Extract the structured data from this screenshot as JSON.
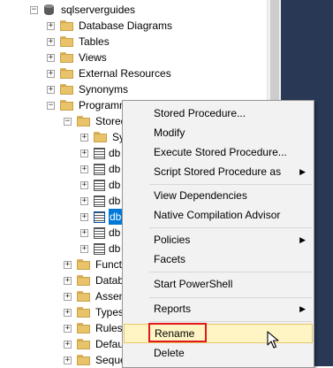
{
  "tree": {
    "db_name": "sqlserverguides",
    "items": [
      {
        "label": "Database Diagrams",
        "expander": "+"
      },
      {
        "label": "Tables",
        "expander": "+"
      },
      {
        "label": "Views",
        "expander": "+"
      },
      {
        "label": "External Resources",
        "expander": "+"
      },
      {
        "label": "Synonyms",
        "expander": "+"
      },
      {
        "label": "Programm",
        "expander": "−"
      },
      {
        "label": "Stored",
        "expander": "−"
      },
      {
        "label": "Sy",
        "expander": "+"
      },
      {
        "label": "db",
        "expander": "+"
      },
      {
        "label": "db",
        "expander": "+"
      },
      {
        "label": "db",
        "expander": "+"
      },
      {
        "label": "db",
        "expander": "+"
      },
      {
        "label": "db",
        "expander": "+",
        "selected": true
      },
      {
        "label": "db",
        "expander": "+"
      },
      {
        "label": "db",
        "expander": "+"
      },
      {
        "label": "Functi",
        "expander": "+"
      },
      {
        "label": "Datab",
        "expander": "+"
      },
      {
        "label": "Assen",
        "expander": "+"
      },
      {
        "label": "Types",
        "expander": "+"
      },
      {
        "label": "Rules",
        "expander": "+"
      },
      {
        "label": "Defau",
        "expander": "+"
      },
      {
        "label": "Seque",
        "expander": "+"
      }
    ],
    "root_expander": "−"
  },
  "context_menu": {
    "items": [
      {
        "label": "Stored Procedure...",
        "submenu": false
      },
      {
        "label": "Modify",
        "submenu": false
      },
      {
        "label": "Execute Stored Procedure...",
        "submenu": false
      },
      {
        "label": "Script Stored Procedure as",
        "submenu": true
      },
      {
        "label": "View Dependencies",
        "submenu": false
      },
      {
        "label": "Native Compilation Advisor",
        "submenu": false
      },
      {
        "label": "Policies",
        "submenu": true
      },
      {
        "label": "Facets",
        "submenu": false
      },
      {
        "label": "Start PowerShell",
        "submenu": false
      },
      {
        "label": "Reports",
        "submenu": true
      },
      {
        "label": "Rename",
        "submenu": false,
        "highlighted": true
      },
      {
        "label": "Delete",
        "submenu": false
      }
    ],
    "submenu_arrow": "▶"
  },
  "colors": {
    "selection": "#0078d7",
    "highlight_box": "#e01a1a",
    "menu_hover": "#fff4c4",
    "background_panel": "#293955"
  }
}
